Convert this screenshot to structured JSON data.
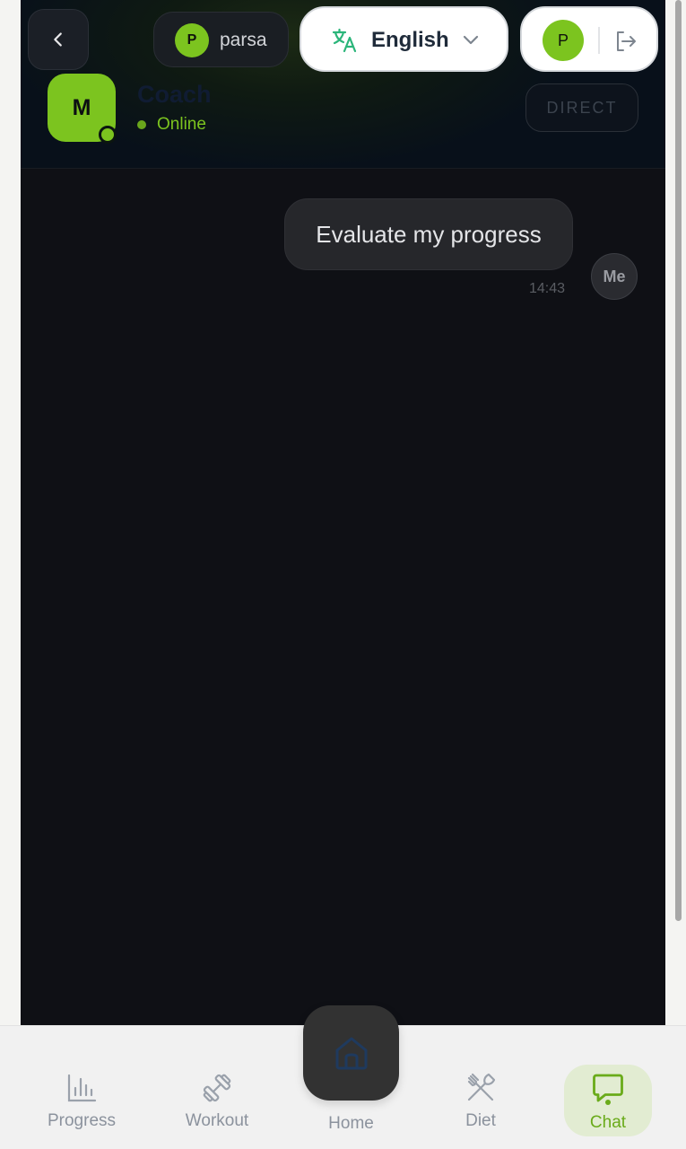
{
  "top_bar": {
    "user_chip": {
      "initial": "P",
      "name": "parsa"
    },
    "language": {
      "label": "English"
    },
    "account": {
      "initial": "P"
    }
  },
  "chat_header": {
    "avatar_initial": "M",
    "name": "Coach",
    "status": "Online",
    "direct_label": "DIRECT"
  },
  "messages": [
    {
      "text": "Evaluate my progress",
      "time": "14:43",
      "sender_label": "Me"
    }
  ],
  "bottom_nav": {
    "progress": "Progress",
    "workout": "Workout",
    "home": "Home",
    "diet": "Diet",
    "chat": "Chat"
  },
  "colors": {
    "accent_green": "#7cc41f",
    "panel_bg": "#0f1015",
    "nav_bg": "#f1f1f1"
  }
}
